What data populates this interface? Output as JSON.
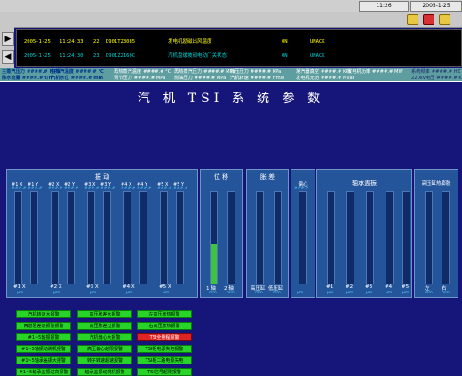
{
  "topbar": {
    "time": "11:26",
    "date": "2005-1-25"
  },
  "alarms": [
    {
      "date": "2005-1-25",
      "time": "11:24:33",
      "num": "22",
      "code": "D901T23085",
      "desc": "发电机励磁出风温度",
      "state": "ON",
      "level": "UNACK",
      "color": "#ffff00"
    },
    {
      "date": "2005-1-25",
      "time": "11:24:30",
      "num": "23",
      "code": "D901Z2160C",
      "desc": "汽机盘缓坡阀电动门关状态",
      "state": "ON",
      "level": "UNACK",
      "color": "#00d0d0"
    }
  ],
  "strip": {
    "row1": [
      {
        "label": "主蒸汽压力",
        "value": "####.# MPa",
        "color": "blue"
      },
      {
        "label": "主蒸汽温度",
        "value": "####.# °C",
        "color": "blue"
      },
      {
        "label": "再热蒸汽温度",
        "value": "####.# °C",
        "color": "white"
      },
      {
        "label": "再热蒸汽压力",
        "value": "####.# MPa",
        "color": "white"
      },
      {
        "label": "背压压力",
        "value": "####.# KPa",
        "color": "white"
      },
      {
        "label": "凝汽器真空",
        "value": "####.# KPa",
        "color": "white"
      },
      {
        "label": "发电机功率",
        "value": "####.# MW",
        "color": "white"
      },
      {
        "label": "系统频率",
        "value": "####.# HZ",
        "color": "dark"
      }
    ],
    "row2": [
      {
        "label": "除水流量",
        "value": "####.# t/h",
        "color": "blue"
      },
      {
        "label": "汽机水位",
        "value": "####.# mm",
        "color": "blue"
      },
      {
        "label": "调节压力",
        "value": "####.# MPa",
        "color": "white"
      },
      {
        "label": "燃油压力",
        "value": "####.# MPa",
        "color": "white"
      },
      {
        "label": "汽机转速",
        "value": "####.# r/min",
        "color": "white"
      },
      {
        "label": "发电机无功",
        "value": "####.# Mvar",
        "color": "white"
      },
      {
        "label": "220kv电压",
        "value": "####.# KV",
        "color": "dark"
      }
    ]
  },
  "title": "汽 机 TSI 系 统 参 数",
  "vibration": {
    "title": "振 动",
    "top_labels": [
      "#1 X",
      "#1 Y",
      "#2 X",
      "#2 Y",
      "#3 X",
      "#3 Y",
      "#4 X",
      "#4 Y",
      "#5 X",
      "#5 Y"
    ],
    "top_values": [
      "###.#",
      "###.#",
      "###.#",
      "###.#",
      "###.#",
      "###.#",
      "###.#",
      "###.#",
      "###.#",
      "###.#"
    ],
    "bottom_labels": [
      "#1 X",
      "#2 X",
      "#3 X",
      "#4 X",
      "#5 X"
    ],
    "units": [
      "μm",
      "μm",
      "μm",
      "μm",
      "μm"
    ],
    "levels": [
      0,
      0,
      0,
      0,
      0,
      0,
      0,
      0,
      0,
      0
    ]
  },
  "displacement": {
    "title": "位 移",
    "labels": [
      "1 轴",
      "2 轴"
    ],
    "units": [
      "mm",
      "mm"
    ],
    "levels": [
      0.44,
      0
    ]
  },
  "expansion": {
    "title": "胀 差",
    "labels": [
      "高压缸",
      "低压缸"
    ],
    "units": [
      "mm",
      "mm"
    ],
    "levels": [
      0,
      0
    ]
  },
  "eccentric": {
    "title": "偏心",
    "value": "###.#",
    "unit": "μm",
    "levels": [
      0
    ]
  },
  "bearing": {
    "title": "轴承盖振",
    "labels": [
      "#1",
      "#2",
      "#3",
      "#4",
      "#5"
    ],
    "units": [
      "μm",
      "μm",
      "μm",
      "μm",
      "μm"
    ],
    "levels": [
      0,
      0,
      0,
      0,
      0
    ]
  },
  "hp_thermal": {
    "title": "高压缸热膨胀",
    "labels": [
      "左",
      "右"
    ],
    "units": [
      "mm",
      "mm"
    ],
    "levels": [
      0,
      0
    ]
  },
  "alarm_buttons": [
    {
      "label": "汽机转速大报警",
      "red": false
    },
    {
      "label": "高压胀差大报警",
      "red": false
    },
    {
      "label": "左高压胀热报警",
      "red": false
    },
    {
      "label": "两道阻差速报警报警",
      "red": false
    },
    {
      "label": "高压胀差过报警",
      "red": false
    },
    {
      "label": "右高压胀热报警",
      "red": false
    },
    {
      "label": "#1~5轴振报警",
      "red": false
    },
    {
      "label": "汽机偏心大报警",
      "red": false
    },
    {
      "label": "TSI全量程报警",
      "red": true
    },
    {
      "label": "#1~5轴振动跳机报警",
      "red": false
    },
    {
      "label": "高压偏心越限报警",
      "red": false
    },
    {
      "label": "TSI柜电源失电报警",
      "red": false
    },
    {
      "label": "#1~5轴承盖振大报警",
      "red": false
    },
    {
      "label": "转子转速超速报警",
      "red": false
    },
    {
      "label": "TSI柜二路电源失电",
      "red": false
    },
    {
      "label": "#1~5轴承盖振过高报警",
      "red": false
    },
    {
      "label": "轴承盖振动跳机报警",
      "red": false
    },
    {
      "label": "TSI信号超限报警",
      "red": false
    }
  ]
}
